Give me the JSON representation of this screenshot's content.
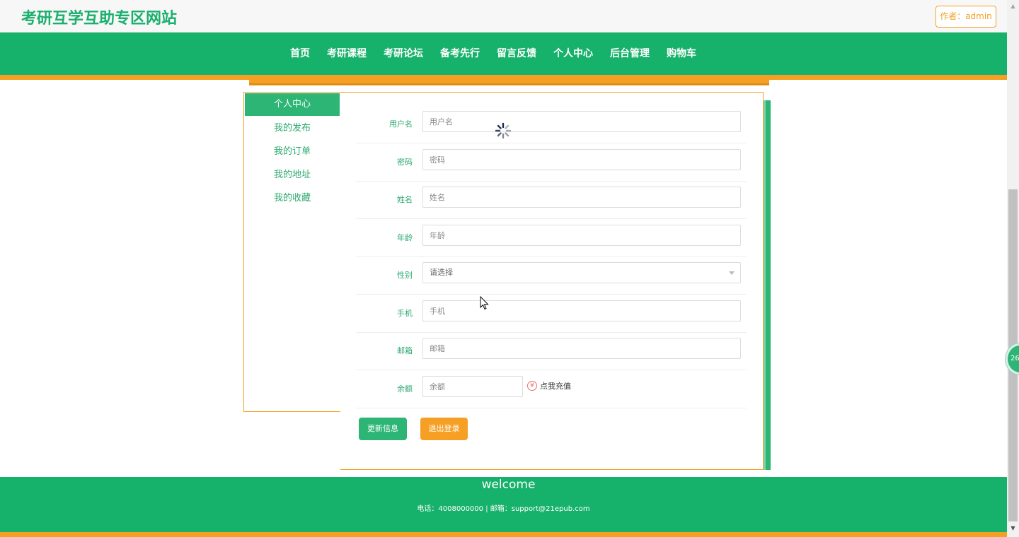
{
  "header": {
    "site_title": "考研互学互助专区网站",
    "author_label": "作者：admin"
  },
  "nav": {
    "items": [
      "首页",
      "考研课程",
      "考研论坛",
      "备考先行",
      "留言反馈",
      "个人中心",
      "后台管理",
      "购物车"
    ]
  },
  "sidebar": {
    "items": [
      "个人中心",
      "我的发布",
      "我的订单",
      "我的地址",
      "我的收藏"
    ],
    "active": "个人中心"
  },
  "form": {
    "username": {
      "label": "用户名",
      "placeholder": "用户名"
    },
    "password": {
      "label": "密码",
      "placeholder": "密码"
    },
    "name": {
      "label": "姓名",
      "placeholder": "姓名"
    },
    "age": {
      "label": "年龄",
      "placeholder": "年龄"
    },
    "gender": {
      "label": "性别",
      "value": "请选择"
    },
    "phone": {
      "label": "手机",
      "placeholder": "手机"
    },
    "email": {
      "label": "邮箱",
      "placeholder": "邮箱"
    },
    "balance": {
      "label": "余额",
      "placeholder": "余额",
      "recharge_label": "点我充值",
      "recharge_icon": "¥"
    }
  },
  "actions": {
    "update_label": "更新信息",
    "logout_label": "退出登录"
  },
  "footer": {
    "title": "welcome",
    "contact": "电话：4008000000 | 邮箱：support@21epub.com"
  },
  "float_badge": {
    "text": "26"
  },
  "colors": {
    "brand_green": "#16b16a",
    "accent_orange": "#f5a025"
  }
}
